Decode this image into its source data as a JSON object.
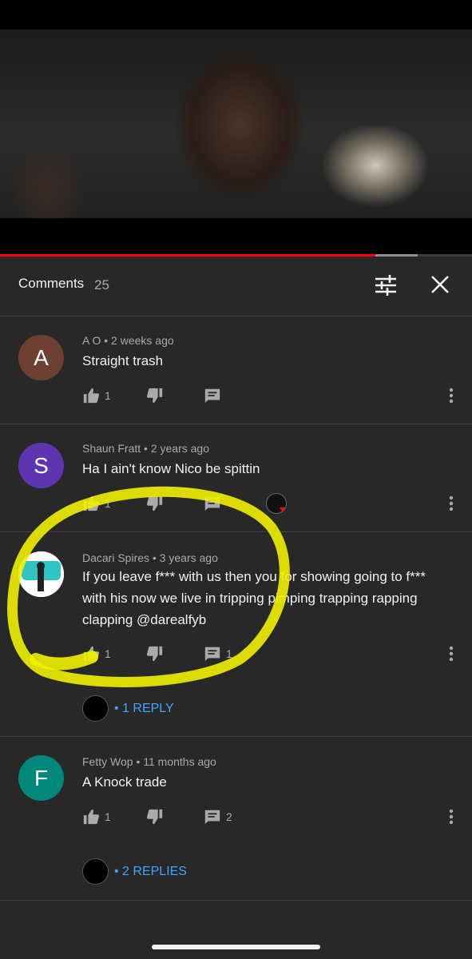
{
  "video": {
    "played_fraction": 0.795,
    "buffered_fraction": 0.885
  },
  "header": {
    "title": "Comments",
    "count": "25",
    "filter_icon": "sort-filter-icon",
    "close_icon": "close-icon"
  },
  "comments": [
    {
      "avatar_letter": "A",
      "avatar_color": "#6d4032",
      "author": "A O",
      "time": "2 weeks ago",
      "text": "Straight trash",
      "likes": "1",
      "replies_count": ""
    },
    {
      "avatar_letter": "S",
      "avatar_color": "#5e35b1",
      "author": "Shaun Fratt",
      "time": "2 years ago",
      "text": "Ha I ain't know Nico be spittin",
      "likes": "1",
      "replies_count": "",
      "creator_heart": true
    },
    {
      "avatar_letter": "",
      "avatar_color": "#ffffff",
      "author": "Dacari Spires",
      "time": "3 years ago",
      "text": "If you leave f*** with us then you for showing going to f*** with his now we live in tripping pimping trapping rapping clapping @darealfyb",
      "likes": "1",
      "replies_count": "1",
      "replies_link": "• 1 REPLY"
    },
    {
      "avatar_letter": "F",
      "avatar_color": "#00897b",
      "author": "Fetty Wop",
      "time": "11 months ago",
      "text": "A Knock trade",
      "likes": "1",
      "replies_count": "2",
      "replies_link": "• 2 REPLIES"
    }
  ],
  "meta_separator": "•",
  "colors": {
    "background": "#282828",
    "accent_link": "#3ea6ff",
    "progress_red": "#ff0000",
    "highlight_marker": "#f0f000"
  }
}
